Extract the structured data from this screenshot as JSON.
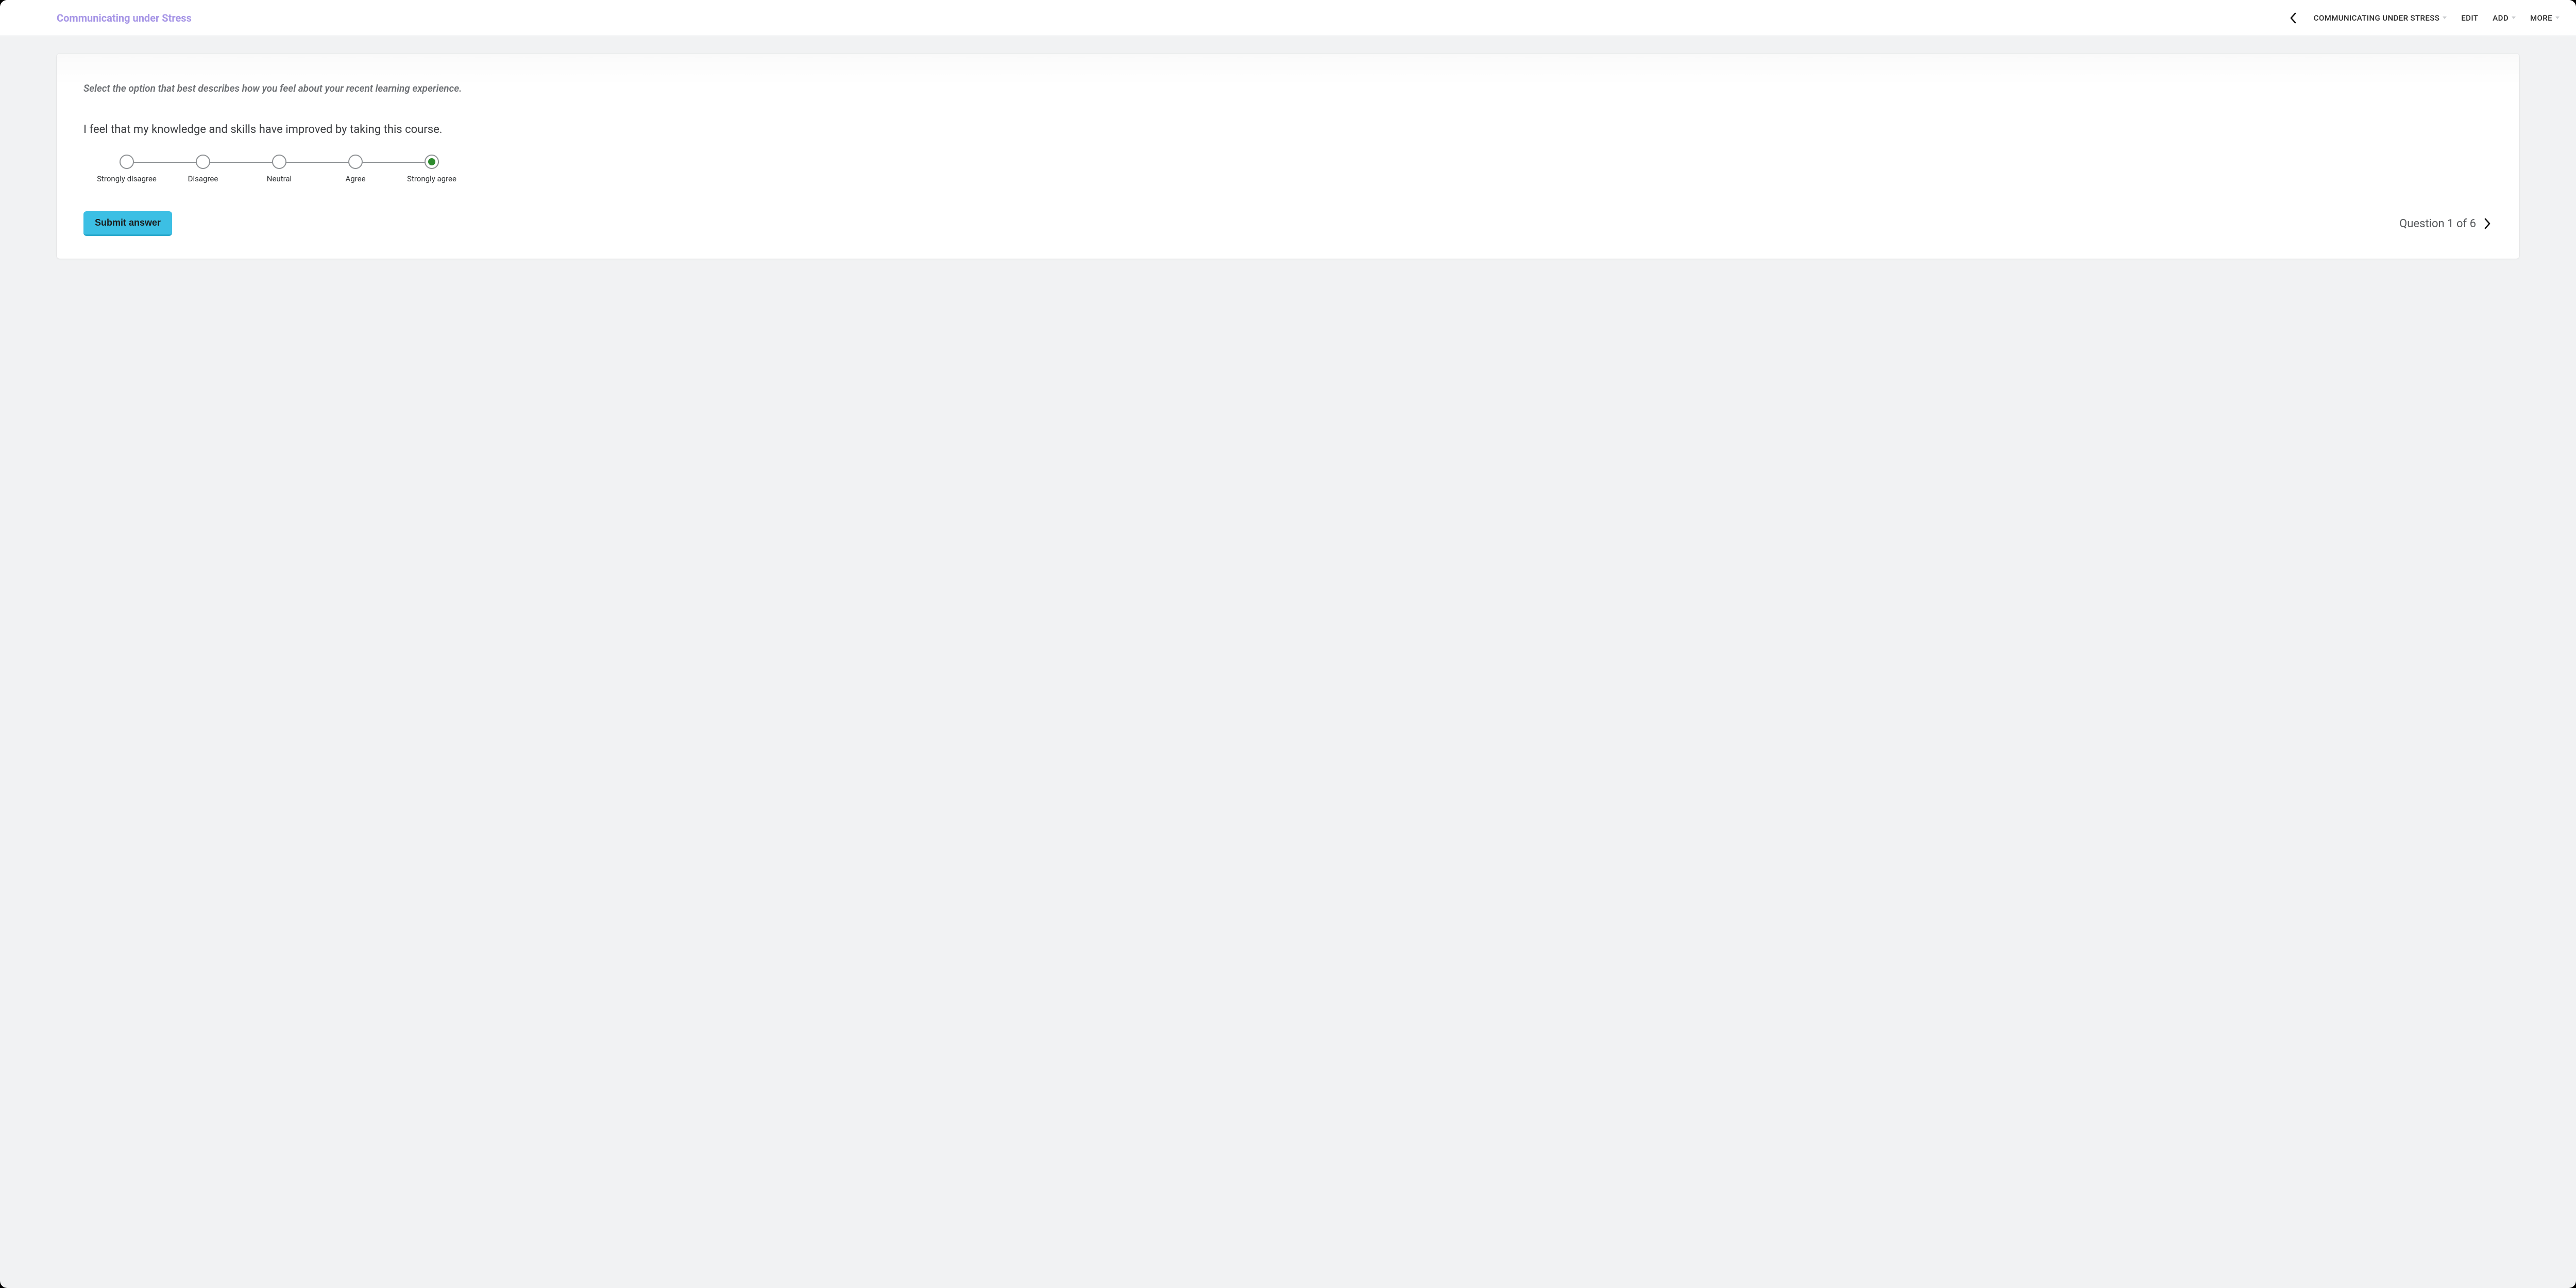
{
  "header": {
    "title": "Communicating under Stress",
    "nav": {
      "course_dropdown": "COMMUNICATING UNDER STRESS",
      "edit": "EDIT",
      "add": "ADD",
      "more": "MORE"
    }
  },
  "card": {
    "instruction": "Select the option that best describes how you feel about your recent learning experience.",
    "question": "I feel that my knowledge and skills have improved by taking this course.",
    "likert": {
      "options": [
        {
          "label": "Strongly disagree",
          "selected": false
        },
        {
          "label": "Disagree",
          "selected": false
        },
        {
          "label": "Neutral",
          "selected": false
        },
        {
          "label": "Agree",
          "selected": false
        },
        {
          "label": "Strongly agree",
          "selected": true
        }
      ]
    },
    "submit_label": "Submit answer",
    "progress_text": "Question 1 of 6"
  }
}
